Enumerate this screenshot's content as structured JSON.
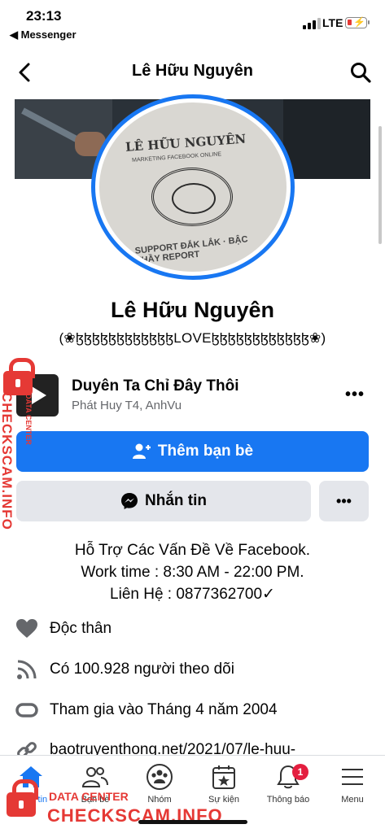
{
  "status": {
    "time": "23:13",
    "back_app": "◀ Messenger",
    "network": "LTE"
  },
  "header": {
    "title": "Lê Hữu Nguyên"
  },
  "avatar": {
    "photo_text_top": "LÊ HỮU NGUYÊN",
    "photo_text_sub": "MARKETING FACEBOOK ONLINE",
    "photo_text_bottom": "SUPPORT ĐẮK LẮK · BẬC THẦY REPORT"
  },
  "profile": {
    "name": "Lê Hữu Nguyên",
    "bio": "(❀ɮɮɮɮɮɮɮɮɮɮɮɮLOVEɮɮɮɮɮɮɮɮɮɮɮɮ❀)"
  },
  "featured": {
    "title": "Duyên Ta Chỉ Đây Thôi",
    "subtitle": "Phát Huy T4, AnhVu",
    "more": "•••"
  },
  "buttons": {
    "add_friend": "Thêm bạn bè",
    "message": "Nhắn tin",
    "more": "•••"
  },
  "intro": [
    "Hỗ Trợ Các Vấn Đề Về Facebook.",
    "Work time : 8:30 AM - 22:00 PM.",
    "Liên Hệ : 0877362700✓"
  ],
  "details": [
    {
      "icon": "heart-icon",
      "text": "Độc thân"
    },
    {
      "icon": "rss-icon",
      "text": "Có 100.928 người theo dõi"
    },
    {
      "icon": "join-icon",
      "text": "Tham gia vào Tháng 4 năm 2004"
    },
    {
      "icon": "link-icon",
      "text": "baotruyenthong.net/2021/07/le-huu-"
    }
  ],
  "nav": {
    "items": [
      {
        "label": "Bảng tin"
      },
      {
        "label": "Bạn bè"
      },
      {
        "label": "Nhóm"
      },
      {
        "label": "Sự kiện"
      },
      {
        "label": "Thông báo",
        "badge": "1"
      },
      {
        "label": "Menu"
      }
    ]
  },
  "watermark": {
    "site": "CHECKSCAM.INFO",
    "tag": "DATA CENTER"
  },
  "colors": {
    "accent": "#1877f2",
    "watermark": "#e53935"
  }
}
